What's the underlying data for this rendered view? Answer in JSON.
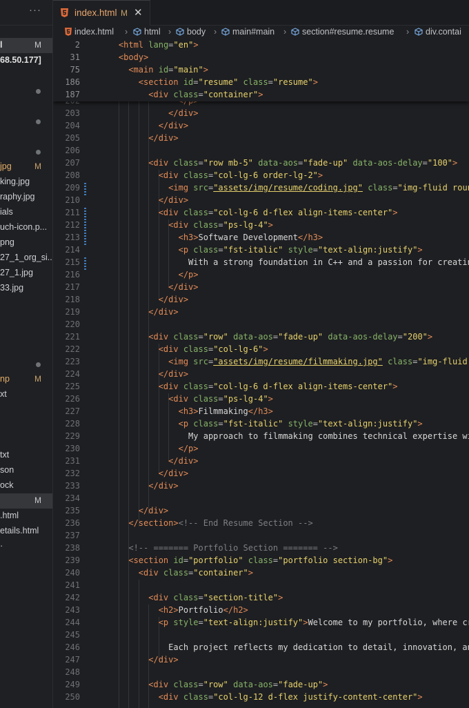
{
  "sidebar": {
    "more_label": "···",
    "rows": [
      {
        "text": "l",
        "badge": "M",
        "bold": true,
        "selected": true,
        "dot": false
      },
      {
        "text": "68.50.177]",
        "badge": "",
        "bold": true,
        "selected": false,
        "dot": false
      },
      {
        "text": "",
        "badge": "",
        "bold": false,
        "selected": false,
        "dot": false
      },
      {
        "text": "",
        "badge": "",
        "bold": false,
        "selected": false,
        "dot": true
      },
      {
        "text": "",
        "badge": "",
        "bold": false,
        "selected": false,
        "dot": false
      },
      {
        "text": "",
        "badge": "",
        "bold": false,
        "selected": false,
        "dot": true
      },
      {
        "text": "",
        "badge": "",
        "bold": false,
        "selected": false,
        "dot": false
      },
      {
        "text": "",
        "badge": "",
        "bold": false,
        "selected": false,
        "dot": true
      },
      {
        "text": "jpg",
        "badge": "M",
        "bold": false,
        "selected": false,
        "dot": false,
        "orange": true
      },
      {
        "text": "king.jpg",
        "badge": "",
        "bold": false,
        "selected": false,
        "dot": false
      },
      {
        "text": "raphy.jpg",
        "badge": "",
        "bold": false,
        "selected": false,
        "dot": false
      },
      {
        "text": "ials",
        "badge": "",
        "bold": false,
        "selected": false,
        "dot": false
      },
      {
        "text": "uch-icon.p...",
        "badge": "",
        "bold": false,
        "selected": false,
        "dot": false
      },
      {
        "text": "png",
        "badge": "",
        "bold": false,
        "selected": false,
        "dot": false
      },
      {
        "text": "27_1_org_si...",
        "badge": "",
        "bold": false,
        "selected": false,
        "dot": false
      },
      {
        "text": "27_1.jpg",
        "badge": "",
        "bold": false,
        "selected": false,
        "dot": false
      },
      {
        "text": "33.jpg",
        "badge": "",
        "bold": false,
        "selected": false,
        "dot": false
      },
      {
        "text": "",
        "badge": "",
        "bold": false,
        "selected": false,
        "dot": false
      },
      {
        "text": "",
        "badge": "",
        "bold": false,
        "selected": false,
        "dot": false
      },
      {
        "text": "",
        "badge": "",
        "bold": false,
        "selected": false,
        "dot": false
      },
      {
        "text": "",
        "badge": "",
        "bold": false,
        "selected": false,
        "dot": false
      },
      {
        "text": "",
        "badge": "",
        "bold": false,
        "selected": false,
        "dot": true
      },
      {
        "text": "np",
        "badge": "M",
        "bold": false,
        "selected": false,
        "dot": false,
        "orange": true
      },
      {
        "text": "xt",
        "badge": "",
        "bold": false,
        "selected": false,
        "dot": false
      },
      {
        "text": "",
        "badge": "",
        "bold": false,
        "selected": false,
        "dot": false
      },
      {
        "text": "",
        "badge": "",
        "bold": false,
        "selected": false,
        "dot": false
      },
      {
        "text": "",
        "badge": "",
        "bold": false,
        "selected": false,
        "dot": false
      },
      {
        "text": "txt",
        "badge": "",
        "bold": false,
        "selected": false,
        "dot": false
      },
      {
        "text": "son",
        "badge": "",
        "bold": false,
        "selected": false,
        "dot": false
      },
      {
        "text": "ock",
        "badge": "",
        "bold": false,
        "selected": false,
        "dot": false
      },
      {
        "text": "",
        "badge": "M",
        "bold": false,
        "selected": true,
        "dot": false
      },
      {
        "text": ".html",
        "badge": "",
        "bold": false,
        "selected": false,
        "dot": false
      },
      {
        "text": "etails.html",
        "badge": "",
        "bold": false,
        "selected": false,
        "dot": false
      },
      {
        "text": "·",
        "badge": "",
        "bold": false,
        "selected": false,
        "dot": false
      }
    ]
  },
  "tab": {
    "filename": "index.html",
    "modified": "M",
    "close": "✕"
  },
  "breadcrumbs": [
    "index.html",
    "html",
    "body",
    "main#main",
    "section#resume.resume",
    "div.contai"
  ],
  "sticky_lines": [
    {
      "n": "2",
      "indent": 4,
      "tokens": [
        [
          "tg",
          "<html "
        ],
        [
          "at",
          "lang"
        ],
        [
          "pu",
          "="
        ],
        [
          "st",
          "\"en\""
        ],
        [
          "tg",
          ">"
        ]
      ]
    },
    {
      "n": "31",
      "indent": 4,
      "tokens": [
        [
          "tg",
          "<body>"
        ]
      ]
    },
    {
      "n": "75",
      "indent": 6,
      "tokens": [
        [
          "tg",
          "<main "
        ],
        [
          "at",
          "id"
        ],
        [
          "pu",
          "="
        ],
        [
          "st",
          "\"main\""
        ],
        [
          "tg",
          ">"
        ]
      ]
    },
    {
      "n": "186",
      "indent": 8,
      "tokens": [
        [
          "tg",
          "<section "
        ],
        [
          "at",
          "id"
        ],
        [
          "pu",
          "="
        ],
        [
          "st",
          "\"resume\" "
        ],
        [
          "at",
          "class"
        ],
        [
          "pu",
          "="
        ],
        [
          "st",
          "\"resume\""
        ],
        [
          "tg",
          ">"
        ]
      ]
    },
    {
      "n": "187",
      "indent": 10,
      "tokens": [
        [
          "tg",
          "<div "
        ],
        [
          "at",
          "class"
        ],
        [
          "pu",
          "="
        ],
        [
          "st",
          "\"container\""
        ],
        [
          "tg",
          ">"
        ]
      ]
    }
  ],
  "code_lines": [
    {
      "n": "202",
      "indent": 16,
      "tokens": [
        [
          "tg",
          "</p>"
        ]
      ]
    },
    {
      "n": "203",
      "indent": 14,
      "tokens": [
        [
          "tg",
          "</div>"
        ]
      ]
    },
    {
      "n": "204",
      "indent": 12,
      "tokens": [
        [
          "tg",
          "</div>"
        ]
      ]
    },
    {
      "n": "205",
      "indent": 10,
      "tokens": [
        [
          "tg",
          "</div>"
        ]
      ]
    },
    {
      "n": "206",
      "indent": 0,
      "tokens": []
    },
    {
      "n": "207",
      "indent": 10,
      "tokens": [
        [
          "tg",
          "<div "
        ],
        [
          "at",
          "class"
        ],
        [
          "pu",
          "="
        ],
        [
          "st",
          "\"row mb-5\" "
        ],
        [
          "at",
          "data-aos"
        ],
        [
          "pu",
          "="
        ],
        [
          "st",
          "\"fade-up\" "
        ],
        [
          "at",
          "data-aos-delay"
        ],
        [
          "pu",
          "="
        ],
        [
          "st",
          "\"100\""
        ],
        [
          "tg",
          ">"
        ]
      ]
    },
    {
      "n": "208",
      "indent": 12,
      "tokens": [
        [
          "tg",
          "<div "
        ],
        [
          "at",
          "class"
        ],
        [
          "pu",
          "="
        ],
        [
          "st",
          "\"col-lg-6 order-lg-2\""
        ],
        [
          "tg",
          ">"
        ]
      ]
    },
    {
      "n": "209",
      "indent": 14,
      "tokens": [
        [
          "tg",
          "<img "
        ],
        [
          "at",
          "src"
        ],
        [
          "pu",
          "="
        ],
        [
          "su",
          "\"assets/img/resume/coding.jpg\""
        ],
        [
          "tx",
          " "
        ],
        [
          "at",
          "class"
        ],
        [
          "pu",
          "="
        ],
        [
          "st",
          "\"img-fluid rounde"
        ]
      ]
    },
    {
      "n": "210",
      "indent": 12,
      "tokens": [
        [
          "tg",
          "</div>"
        ]
      ]
    },
    {
      "n": "211",
      "indent": 12,
      "tokens": [
        [
          "tg",
          "<div "
        ],
        [
          "at",
          "class"
        ],
        [
          "pu",
          "="
        ],
        [
          "st",
          "\"col-lg-6 d-flex align-items-center\""
        ],
        [
          "tg",
          ">"
        ]
      ]
    },
    {
      "n": "212",
      "indent": 14,
      "tokens": [
        [
          "tg",
          "<div "
        ],
        [
          "at",
          "class"
        ],
        [
          "pu",
          "="
        ],
        [
          "st",
          "\"ps-lg-4\""
        ],
        [
          "tg",
          ">"
        ]
      ]
    },
    {
      "n": "213",
      "indent": 16,
      "tokens": [
        [
          "tg",
          "<h3>"
        ],
        [
          "tx",
          "Software Development"
        ],
        [
          "tg",
          "</h3>"
        ]
      ]
    },
    {
      "n": "214",
      "indent": 16,
      "tokens": [
        [
          "tg",
          "<p "
        ],
        [
          "at",
          "class"
        ],
        [
          "pu",
          "="
        ],
        [
          "st",
          "\"fst-italic\" "
        ],
        [
          "at",
          "style"
        ],
        [
          "pu",
          "="
        ],
        [
          "st",
          "\"text-align:justify\""
        ],
        [
          "tg",
          ">"
        ]
      ]
    },
    {
      "n": "215",
      "indent": 18,
      "tokens": [
        [
          "tx",
          "With a strong foundation in C++ and a passion for creating"
        ]
      ]
    },
    {
      "n": "216",
      "indent": 16,
      "tokens": [
        [
          "tg",
          "</p>"
        ]
      ]
    },
    {
      "n": "217",
      "indent": 14,
      "tokens": [
        [
          "tg",
          "</div>"
        ]
      ]
    },
    {
      "n": "218",
      "indent": 12,
      "tokens": [
        [
          "tg",
          "</div>"
        ]
      ]
    },
    {
      "n": "219",
      "indent": 10,
      "tokens": [
        [
          "tg",
          "</div>"
        ]
      ]
    },
    {
      "n": "220",
      "indent": 0,
      "tokens": []
    },
    {
      "n": "221",
      "indent": 10,
      "tokens": [
        [
          "tg",
          "<div "
        ],
        [
          "at",
          "class"
        ],
        [
          "pu",
          "="
        ],
        [
          "st",
          "\"row\" "
        ],
        [
          "at",
          "data-aos"
        ],
        [
          "pu",
          "="
        ],
        [
          "st",
          "\"fade-up\" "
        ],
        [
          "at",
          "data-aos-delay"
        ],
        [
          "pu",
          "="
        ],
        [
          "st",
          "\"200\""
        ],
        [
          "tg",
          ">"
        ]
      ]
    },
    {
      "n": "222",
      "indent": 12,
      "tokens": [
        [
          "tg",
          "<div "
        ],
        [
          "at",
          "class"
        ],
        [
          "pu",
          "="
        ],
        [
          "st",
          "\"col-lg-6\""
        ],
        [
          "tg",
          ">"
        ]
      ]
    },
    {
      "n": "223",
      "indent": 14,
      "tokens": [
        [
          "tg",
          "<img "
        ],
        [
          "at",
          "src"
        ],
        [
          "pu",
          "="
        ],
        [
          "su",
          "\"assets/img/resume/filmmaking.jpg\""
        ],
        [
          "tx",
          " "
        ],
        [
          "at",
          "class"
        ],
        [
          "pu",
          "="
        ],
        [
          "st",
          "\"img-fluid ro"
        ]
      ]
    },
    {
      "n": "224",
      "indent": 12,
      "tokens": [
        [
          "tg",
          "</div>"
        ]
      ]
    },
    {
      "n": "225",
      "indent": 12,
      "tokens": [
        [
          "tg",
          "<div "
        ],
        [
          "at",
          "class"
        ],
        [
          "pu",
          "="
        ],
        [
          "st",
          "\"col-lg-6 d-flex align-items-center\""
        ],
        [
          "tg",
          ">"
        ]
      ]
    },
    {
      "n": "226",
      "indent": 14,
      "tokens": [
        [
          "tg",
          "<div "
        ],
        [
          "at",
          "class"
        ],
        [
          "pu",
          "="
        ],
        [
          "st",
          "\"ps-lg-4\""
        ],
        [
          "tg",
          ">"
        ]
      ]
    },
    {
      "n": "227",
      "indent": 16,
      "tokens": [
        [
          "tg",
          "<h3>"
        ],
        [
          "tx",
          "Filmmaking"
        ],
        [
          "tg",
          "</h3>"
        ]
      ]
    },
    {
      "n": "228",
      "indent": 16,
      "tokens": [
        [
          "tg",
          "<p "
        ],
        [
          "at",
          "class"
        ],
        [
          "pu",
          "="
        ],
        [
          "st",
          "\"fst-italic\" "
        ],
        [
          "at",
          "style"
        ],
        [
          "pu",
          "="
        ],
        [
          "st",
          "\"text-align:justify\""
        ],
        [
          "tg",
          ">"
        ]
      ]
    },
    {
      "n": "229",
      "indent": 18,
      "tokens": [
        [
          "tx",
          "My approach to filmmaking combines technical expertise with"
        ]
      ]
    },
    {
      "n": "230",
      "indent": 16,
      "tokens": [
        [
          "tg",
          "</p>"
        ]
      ]
    },
    {
      "n": "231",
      "indent": 14,
      "tokens": [
        [
          "tg",
          "</div>"
        ]
      ]
    },
    {
      "n": "232",
      "indent": 12,
      "tokens": [
        [
          "tg",
          "</div>"
        ]
      ]
    },
    {
      "n": "233",
      "indent": 10,
      "tokens": [
        [
          "tg",
          "</div>"
        ]
      ]
    },
    {
      "n": "234",
      "indent": 0,
      "tokens": []
    },
    {
      "n": "235",
      "indent": 8,
      "tokens": [
        [
          "tg",
          "</div>"
        ]
      ]
    },
    {
      "n": "236",
      "indent": 6,
      "tokens": [
        [
          "tg",
          "</section>"
        ],
        [
          "cm",
          "<!-- End Resume Section -->"
        ]
      ]
    },
    {
      "n": "237",
      "indent": 0,
      "tokens": []
    },
    {
      "n": "238",
      "indent": 6,
      "tokens": [
        [
          "cm",
          "<!-- ======= Portfolio Section ======= -->"
        ]
      ]
    },
    {
      "n": "239",
      "indent": 6,
      "tokens": [
        [
          "tg",
          "<section "
        ],
        [
          "at",
          "id"
        ],
        [
          "pu",
          "="
        ],
        [
          "st",
          "\"portfolio\" "
        ],
        [
          "at",
          "class"
        ],
        [
          "pu",
          "="
        ],
        [
          "st",
          "\"portfolio section-bg\""
        ],
        [
          "tg",
          ">"
        ]
      ]
    },
    {
      "n": "240",
      "indent": 8,
      "tokens": [
        [
          "tg",
          "<div "
        ],
        [
          "at",
          "class"
        ],
        [
          "pu",
          "="
        ],
        [
          "st",
          "\"container\""
        ],
        [
          "tg",
          ">"
        ]
      ]
    },
    {
      "n": "241",
      "indent": 0,
      "tokens": []
    },
    {
      "n": "242",
      "indent": 10,
      "tokens": [
        [
          "tg",
          "<div "
        ],
        [
          "at",
          "class"
        ],
        [
          "pu",
          "="
        ],
        [
          "st",
          "\"section-title\""
        ],
        [
          "tg",
          ">"
        ]
      ]
    },
    {
      "n": "243",
      "indent": 12,
      "tokens": [
        [
          "tg",
          "<h2>"
        ],
        [
          "tx",
          "Portfolio"
        ],
        [
          "tg",
          "</h2>"
        ]
      ]
    },
    {
      "n": "244",
      "indent": 12,
      "tokens": [
        [
          "tg",
          "<p "
        ],
        [
          "at",
          "style"
        ],
        [
          "pu",
          "="
        ],
        [
          "st",
          "\"text-align:justify\""
        ],
        [
          "tg",
          ">"
        ],
        [
          "tx",
          "Welcome to my portfolio, where crea"
        ]
      ]
    },
    {
      "n": "245",
      "indent": 0,
      "tokens": []
    },
    {
      "n": "246",
      "indent": 14,
      "tokens": [
        [
          "tx",
          "Each project reflects my dedication to detail, innovation, and"
        ]
      ]
    },
    {
      "n": "247",
      "indent": 10,
      "tokens": [
        [
          "tg",
          "</div>"
        ]
      ]
    },
    {
      "n": "248",
      "indent": 0,
      "tokens": []
    },
    {
      "n": "249",
      "indent": 10,
      "tokens": [
        [
          "tg",
          "<div "
        ],
        [
          "at",
          "class"
        ],
        [
          "pu",
          "="
        ],
        [
          "st",
          "\"row\" "
        ],
        [
          "at",
          "data-aos"
        ],
        [
          "pu",
          "="
        ],
        [
          "st",
          "\"fade-up\""
        ],
        [
          "tg",
          ">"
        ]
      ]
    },
    {
      "n": "250",
      "indent": 12,
      "tokens": [
        [
          "tg",
          "<div "
        ],
        [
          "at",
          "class"
        ],
        [
          "pu",
          "="
        ],
        [
          "st",
          "\"col-lg-12 d-flex justify-content-center\""
        ],
        [
          "tg",
          ">"
        ]
      ]
    }
  ]
}
